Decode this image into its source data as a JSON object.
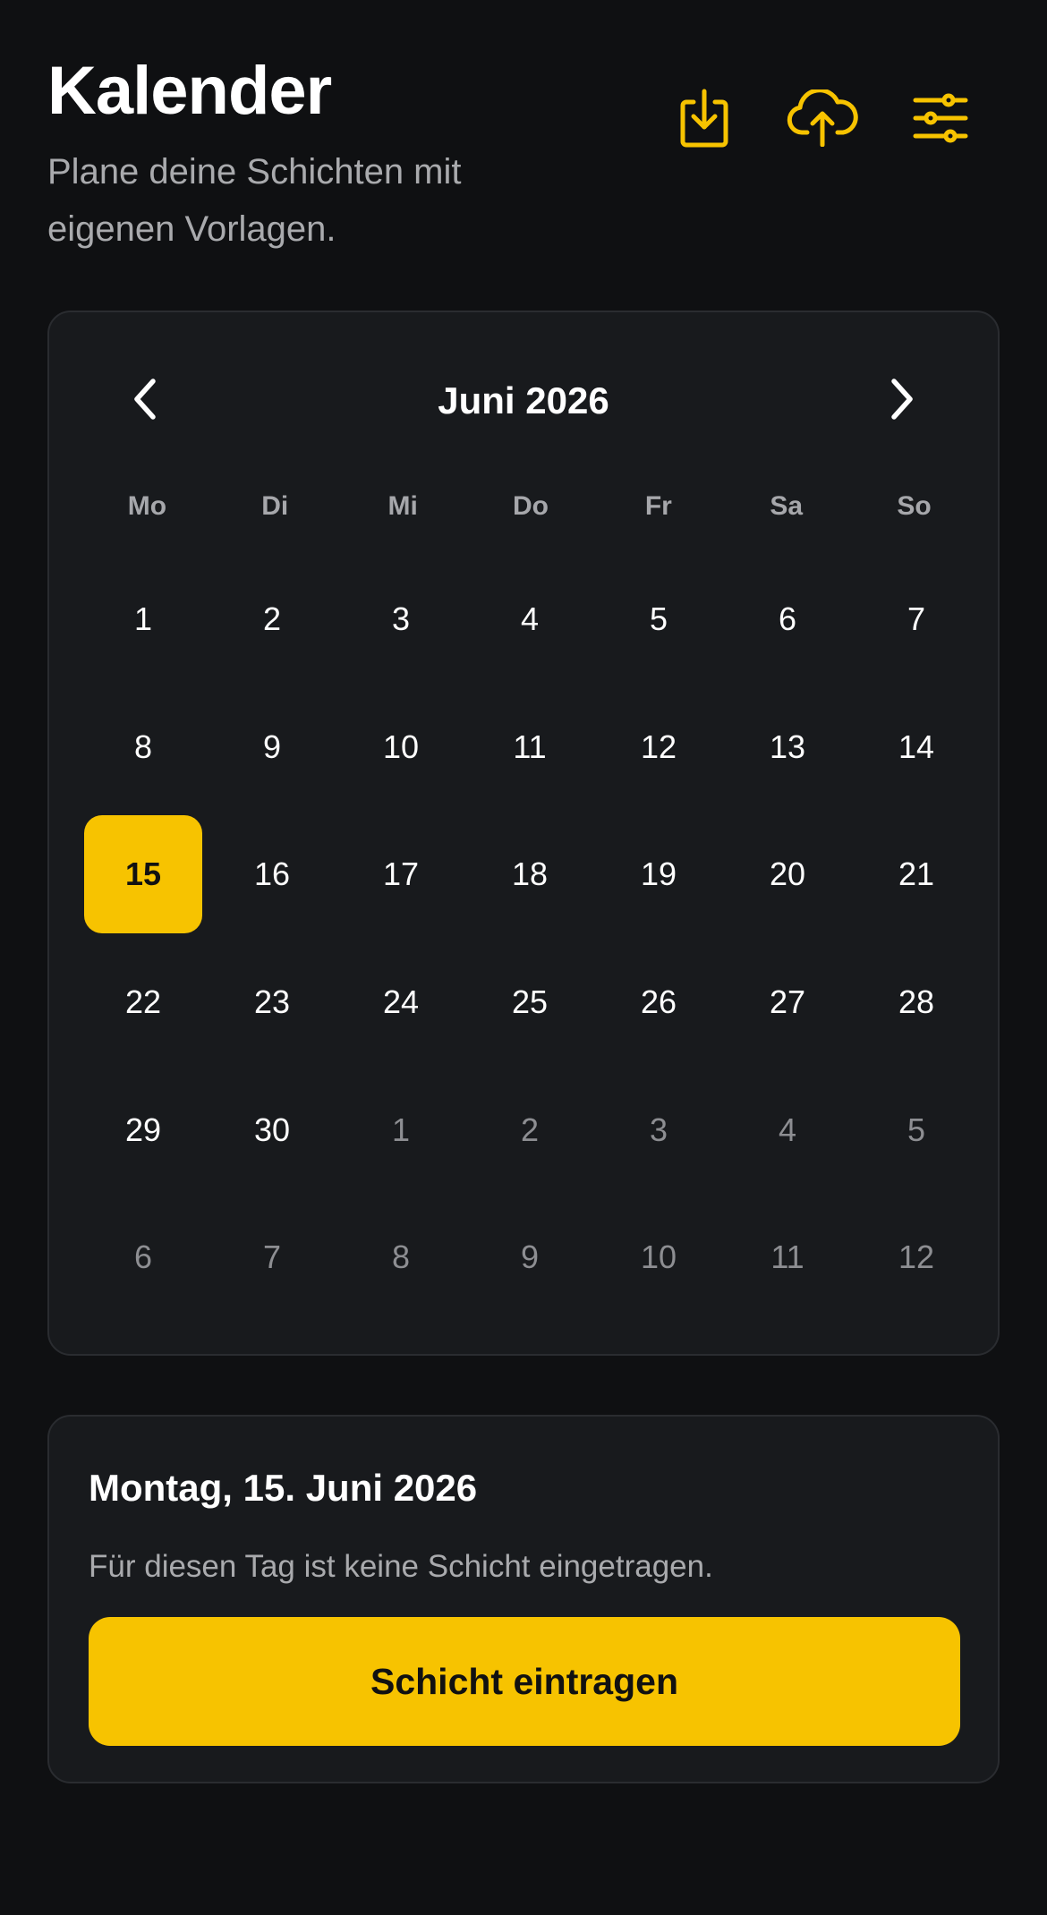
{
  "header": {
    "title": "Kalender",
    "subtitle": "Plane deine Schichten mit eigenen Vorlagen."
  },
  "actions": [
    {
      "name": "download-icon",
      "icon": "download-icon"
    },
    {
      "name": "cloud-upload-icon",
      "icon": "cloud-upload-icon"
    },
    {
      "name": "sliders-icon",
      "icon": "sliders-icon"
    }
  ],
  "calendar": {
    "month_label": "Juni 2026",
    "weekdays": [
      "Mo",
      "Di",
      "Mi",
      "Do",
      "Fr",
      "Sa",
      "So"
    ],
    "days": [
      {
        "label": "1",
        "current": true
      },
      {
        "label": "2",
        "current": true
      },
      {
        "label": "3",
        "current": true
      },
      {
        "label": "4",
        "current": true
      },
      {
        "label": "5",
        "current": true
      },
      {
        "label": "6",
        "current": true
      },
      {
        "label": "7",
        "current": true
      },
      {
        "label": "8",
        "current": true
      },
      {
        "label": "9",
        "current": true
      },
      {
        "label": "10",
        "current": true
      },
      {
        "label": "11",
        "current": true
      },
      {
        "label": "12",
        "current": true
      },
      {
        "label": "13",
        "current": true
      },
      {
        "label": "14",
        "current": true
      },
      {
        "label": "15",
        "current": true,
        "selected": true
      },
      {
        "label": "16",
        "current": true
      },
      {
        "label": "17",
        "current": true
      },
      {
        "label": "18",
        "current": true
      },
      {
        "label": "19",
        "current": true
      },
      {
        "label": "20",
        "current": true
      },
      {
        "label": "21",
        "current": true
      },
      {
        "label": "22",
        "current": true
      },
      {
        "label": "23",
        "current": true
      },
      {
        "label": "24",
        "current": true
      },
      {
        "label": "25",
        "current": true
      },
      {
        "label": "26",
        "current": true
      },
      {
        "label": "27",
        "current": true
      },
      {
        "label": "28",
        "current": true
      },
      {
        "label": "29",
        "current": true
      },
      {
        "label": "30",
        "current": true
      },
      {
        "label": "1",
        "current": false
      },
      {
        "label": "2",
        "current": false
      },
      {
        "label": "3",
        "current": false
      },
      {
        "label": "4",
        "current": false
      },
      {
        "label": "5",
        "current": false
      },
      {
        "label": "6",
        "current": false
      },
      {
        "label": "7",
        "current": false
      },
      {
        "label": "8",
        "current": false
      },
      {
        "label": "9",
        "current": false
      },
      {
        "label": "10",
        "current": false
      },
      {
        "label": "11",
        "current": false
      },
      {
        "label": "12",
        "current": false
      }
    ]
  },
  "detail": {
    "date_label": "Montag, 15. Juni 2026",
    "empty_text": "Für diesen Tag ist keine Schicht eingetragen.",
    "button_label": "Schicht eintragen"
  },
  "colors": {
    "accent": "#f7c300",
    "background": "#0f1012",
    "card": "#181a1d",
    "muted_text": "#a9aaad"
  }
}
